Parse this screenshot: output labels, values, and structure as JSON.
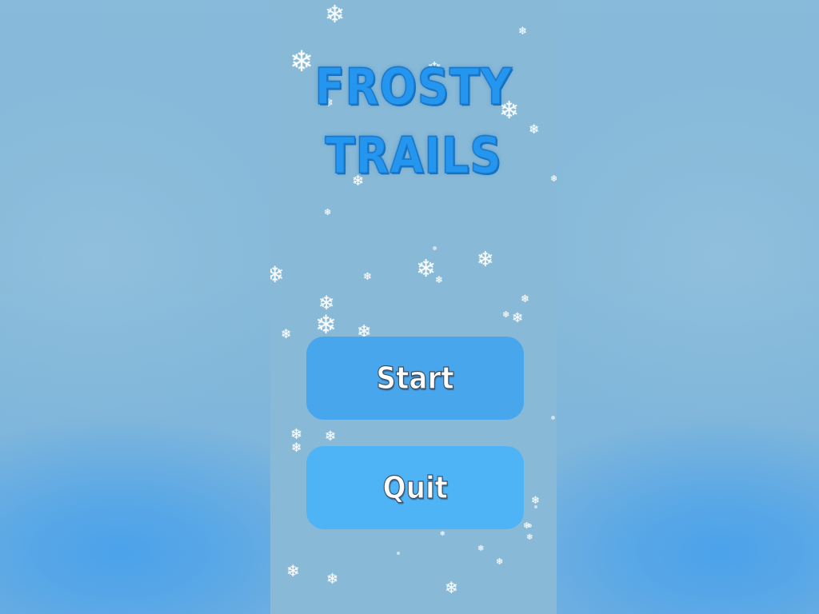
{
  "game": {
    "title_line1": "FROSTY",
    "title_line2": "TRAILS",
    "menu": {
      "start_label": "Start",
      "quit_label": "Quit"
    }
  },
  "colors": {
    "title": "#2596ef",
    "start_button": "#48a6ec",
    "quit_button": "#4fb4f6",
    "panel_background": "#88b9d7",
    "outer_background": "#86b9d9"
  },
  "decor": {
    "snowflake_glyph": "❄"
  }
}
